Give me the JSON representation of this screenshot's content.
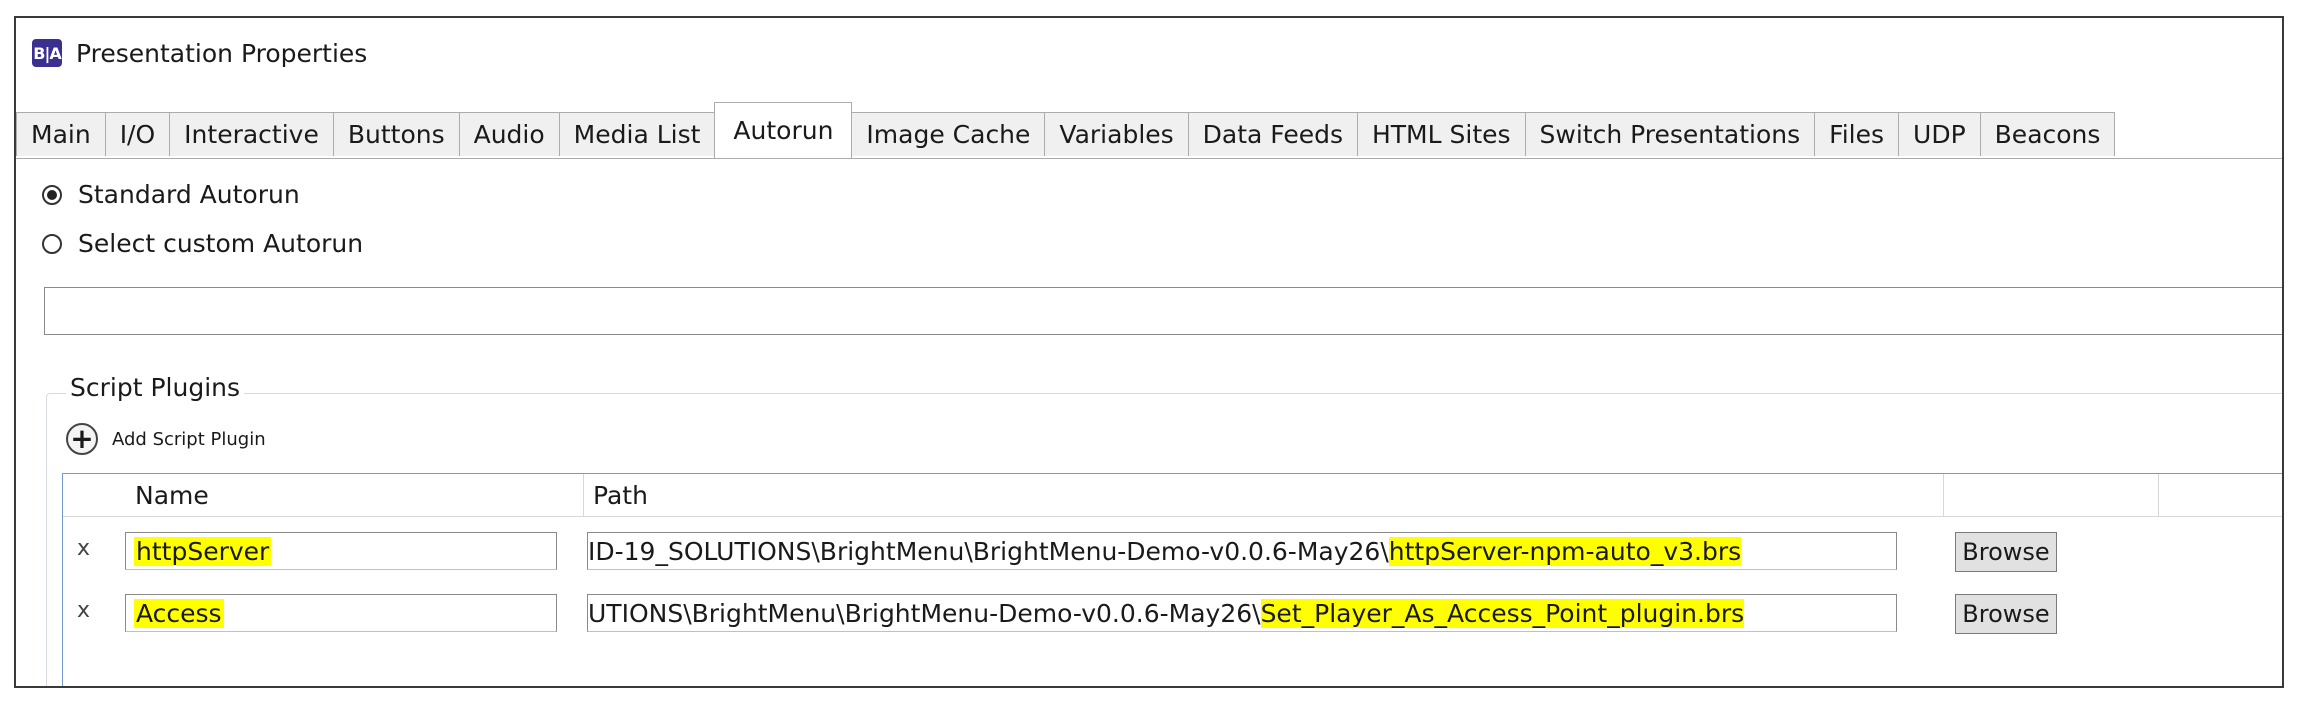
{
  "window": {
    "app_icon_text": "B|A",
    "title": "Presentation Properties"
  },
  "tabs": [
    {
      "label": "Main"
    },
    {
      "label": "I/O"
    },
    {
      "label": "Interactive"
    },
    {
      "label": "Buttons"
    },
    {
      "label": "Audio"
    },
    {
      "label": "Media List"
    },
    {
      "label": "Autorun"
    },
    {
      "label": "Image Cache"
    },
    {
      "label": "Variables"
    },
    {
      "label": "Data Feeds"
    },
    {
      "label": "HTML Sites"
    },
    {
      "label": "Switch Presentations"
    },
    {
      "label": "Files"
    },
    {
      "label": "UDP"
    },
    {
      "label": "Beacons"
    }
  ],
  "active_tab": "Autorun",
  "autorun": {
    "standard_label": "Standard Autorun",
    "custom_label": "Select custom Autorun",
    "selected": "standard",
    "custom_path_value": ""
  },
  "script_plugins": {
    "group_label": "Script Plugins",
    "add_label": "Add Script Plugin",
    "columns": {
      "name": "Name",
      "path": "Path"
    },
    "rows": [
      {
        "remove": "x",
        "name": "httpServer",
        "path_prefix": "ID-19_SOLUTIONS\\BrightMenu\\BrightMenu-Demo-v0.0.6-May26\\",
        "path_file": "httpServer-npm-auto_v3.brs",
        "browse_label": "Browse"
      },
      {
        "remove": "x",
        "name": "Access",
        "path_prefix": "UTIONS\\BrightMenu\\BrightMenu-Demo-v0.0.6-May26\\",
        "path_file": "Set_Player_As_Access_Point_plugin.brs",
        "browse_label": "Browse"
      }
    ]
  },
  "colors": {
    "highlight": "#ffff00",
    "app_icon": "#3b2f8f",
    "grid_border": "#6f9bd1"
  }
}
